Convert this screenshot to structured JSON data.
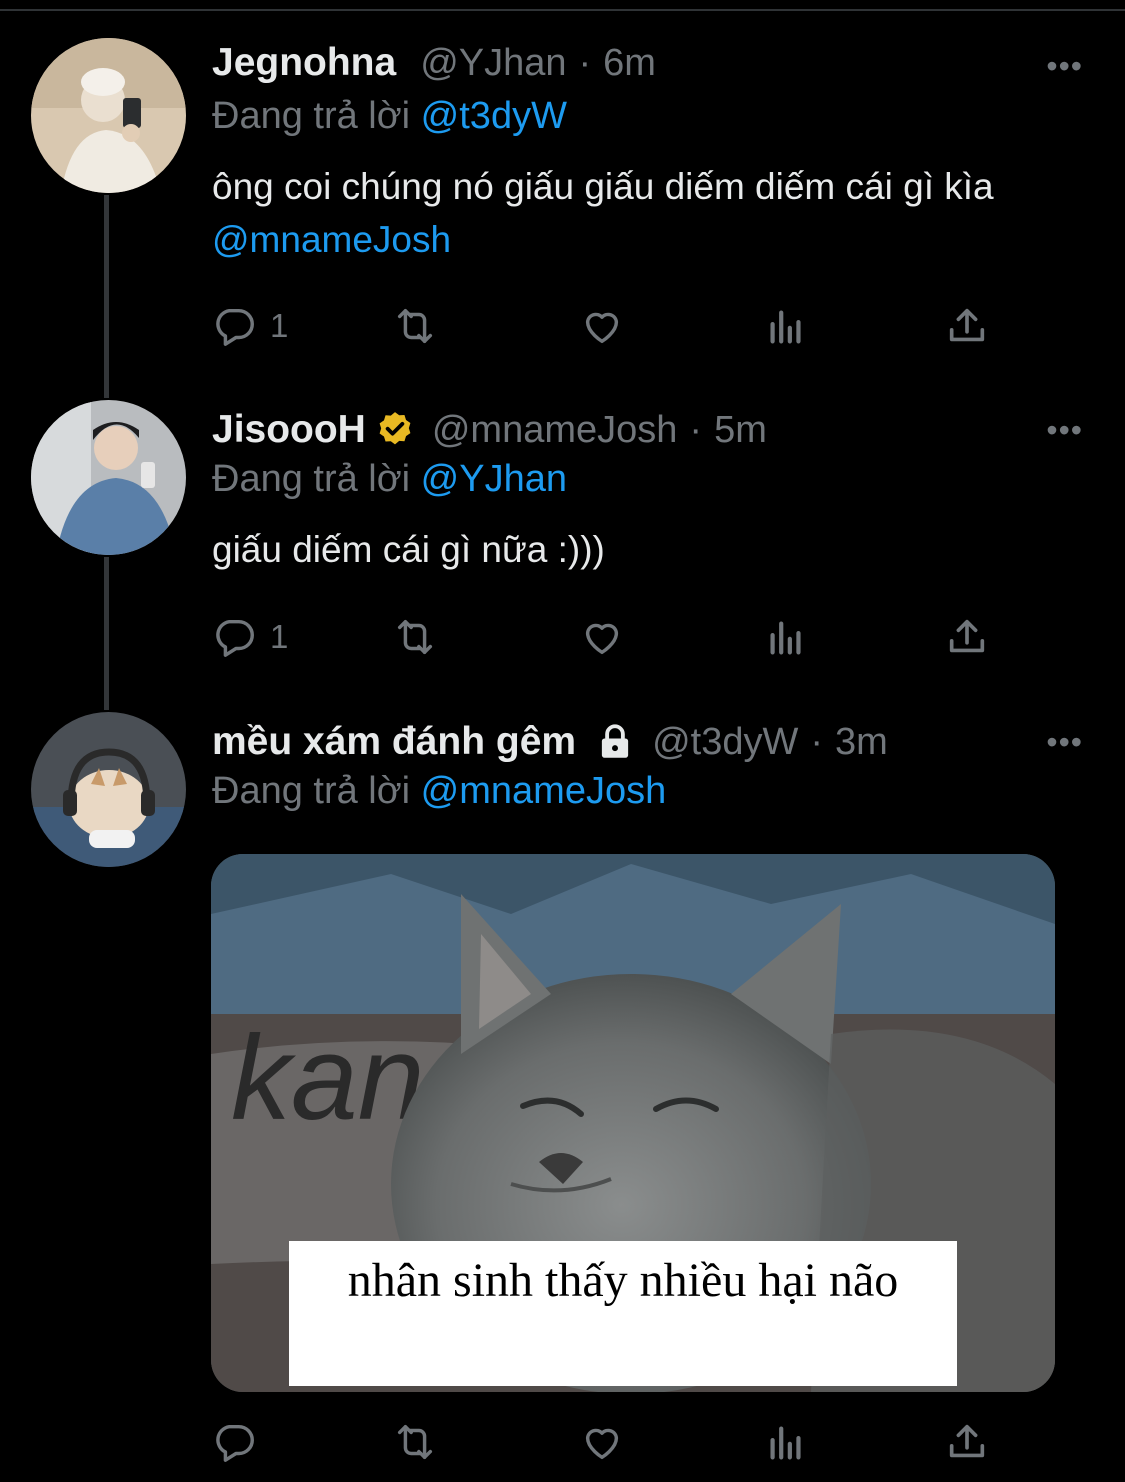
{
  "tweets": [
    {
      "name": "Jegnohna",
      "handle": "@YJhan",
      "time": "6m",
      "replying_prefix": "Đang trả lời",
      "replying_to": "@t3dyW",
      "text_plain": "ông coi chúng nó giấu giấu diếm diếm cái gì kìa",
      "text_mention": "@mnameJosh",
      "reply_count": "1",
      "more": "•••"
    },
    {
      "name": "JisoooH",
      "verified": true,
      "handle": "@mnameJosh",
      "time": "5m",
      "replying_prefix": "Đang trả lời",
      "replying_to": "@YJhan",
      "text_plain": "giấu diếm cái gì nữa :)))",
      "reply_count": "1",
      "more": "•••"
    },
    {
      "name": "mều xám đánh gêm",
      "protected": true,
      "handle": "@t3dyW",
      "time": "3m",
      "replying_prefix": "Đang trả lời",
      "replying_to": "@mnameJosh",
      "media_caption": "nhân sinh thấy nhiều hại não",
      "media_partial_text": "kan",
      "reply_count": "",
      "more": "•••"
    }
  ],
  "separator": "·",
  "icons": [
    "reply-icon",
    "retweet-icon",
    "like-icon",
    "views-icon",
    "share-icon",
    "verified-badge-icon",
    "lock-icon",
    "more-icon"
  ],
  "colors": {
    "background": "#000000",
    "text": "#e7e9ea",
    "muted": "#71767b",
    "link": "#1d9bf0",
    "verified": "#e8b923"
  }
}
